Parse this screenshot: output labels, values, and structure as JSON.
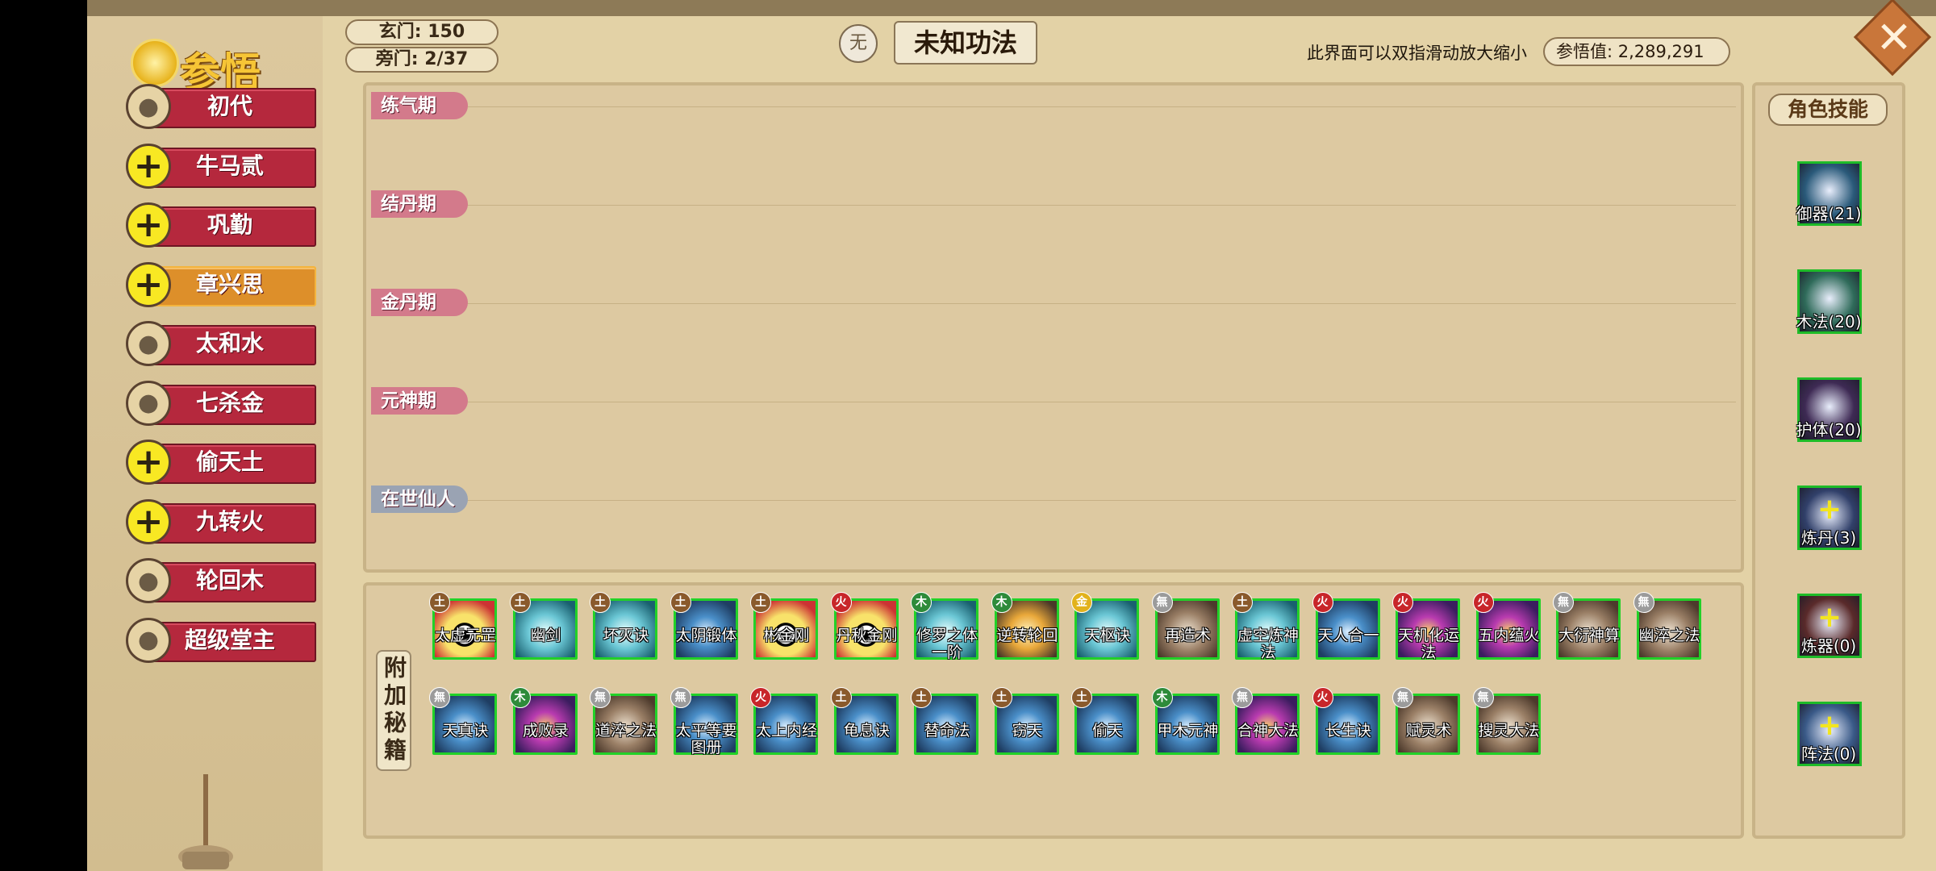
{
  "header": {
    "title": "参悟",
    "xuanmen": "玄门: 150",
    "pangmen": "旁门: 2/37",
    "element_badge": "无",
    "method_title": "未知功法",
    "hint": "此界面可以双指滑动放大缩小",
    "enlightenment_value": "参悟值: 2,289,291"
  },
  "characters": [
    {
      "name": "初代",
      "avatar": "portrait"
    },
    {
      "name": "牛马贰",
      "avatar": "plus"
    },
    {
      "name": "巩勤",
      "avatar": "plus"
    },
    {
      "name": "章兴思",
      "avatar": "plus",
      "selected": true
    },
    {
      "name": "太和水",
      "avatar": "portrait"
    },
    {
      "name": "七杀金",
      "avatar": "portrait"
    },
    {
      "name": "偷天土",
      "avatar": "plus"
    },
    {
      "name": "九转火",
      "avatar": "plus"
    },
    {
      "name": "轮回木",
      "avatar": "portrait"
    },
    {
      "name": "超级堂主",
      "avatar": "portrait"
    }
  ],
  "realms": [
    "练气期",
    "结丹期",
    "金丹期",
    "元神期",
    "在世仙人"
  ],
  "books_panel_label": "附加秘籍",
  "books": [
    {
      "name": "太虚元罡",
      "element": "土",
      "style": "flame"
    },
    {
      "name": "幽剑",
      "element": "土",
      "style": "teal"
    },
    {
      "name": "坏灭诀",
      "element": "土",
      "style": "teal"
    },
    {
      "name": "太阴锻体",
      "element": "土",
      "style": "blue"
    },
    {
      "name": "彬金刚",
      "element": "土",
      "style": "flame"
    },
    {
      "name": "丹秋金刚",
      "element": "火",
      "style": "flame"
    },
    {
      "name": "修罗之体一阶",
      "element": "木",
      "style": "teal"
    },
    {
      "name": "逆转轮回",
      "element": "木",
      "style": "sun"
    },
    {
      "name": "天枢诀",
      "element": "金",
      "style": "teal"
    },
    {
      "name": "再造术",
      "element": "無",
      "style": "earth"
    },
    {
      "name": "虚空炼神法",
      "element": "土",
      "style": "teal"
    },
    {
      "name": "天人合一",
      "element": "火",
      "style": "blue"
    },
    {
      "name": "天机化运法",
      "element": "火",
      "style": "purple"
    },
    {
      "name": "五内蕴火",
      "element": "火",
      "style": "purple"
    },
    {
      "name": "大衍神算",
      "element": "無",
      "style": "earth"
    },
    {
      "name": "幽淬之法",
      "element": "無",
      "style": "earth"
    },
    {
      "name": "天真诀",
      "element": "無",
      "style": "blue"
    },
    {
      "name": "成败录",
      "element": "木",
      "style": "purple"
    },
    {
      "name": "道淬之法",
      "element": "無",
      "style": "earth"
    },
    {
      "name": "太平等要图册",
      "element": "無",
      "style": "blue"
    },
    {
      "name": "太上内经",
      "element": "火",
      "style": "blue"
    },
    {
      "name": "龟息诀",
      "element": "土",
      "style": "blue"
    },
    {
      "name": "替命法",
      "element": "土",
      "style": "blue"
    },
    {
      "name": "窃天",
      "element": "土",
      "style": "blue"
    },
    {
      "name": "偷天",
      "element": "土",
      "style": "blue"
    },
    {
      "name": "甲木元神",
      "element": "木",
      "style": "blue"
    },
    {
      "name": "合神大法",
      "element": "無",
      "style": "purple"
    },
    {
      "name": "长生诀",
      "element": "火",
      "style": "blue"
    },
    {
      "name": "赋灵术",
      "element": "無",
      "style": "earth"
    },
    {
      "name": "搜灵大法",
      "element": "無",
      "style": "earth"
    }
  ],
  "element_colors": {
    "土": "#8a5a2c",
    "火": "#c8262a",
    "木": "#2e8b3a",
    "金": "#e2b21c",
    "無": "#9b9b9b"
  },
  "skills_title": "角色技能",
  "skills": [
    {
      "name": "御器(21)",
      "has_plus": false,
      "color": "#2a5a7a"
    },
    {
      "name": "木法(20)",
      "has_plus": false,
      "color": "#2f6b5a"
    },
    {
      "name": "护体(20)",
      "has_plus": false,
      "color": "#3e2a54"
    },
    {
      "name": "炼丹(3)",
      "has_plus": true,
      "color": "#31406a"
    },
    {
      "name": "炼器(0)",
      "has_plus": true,
      "color": "#5a2a2a"
    },
    {
      "name": "阵法(0)",
      "has_plus": true,
      "color": "#3a5a88"
    }
  ]
}
